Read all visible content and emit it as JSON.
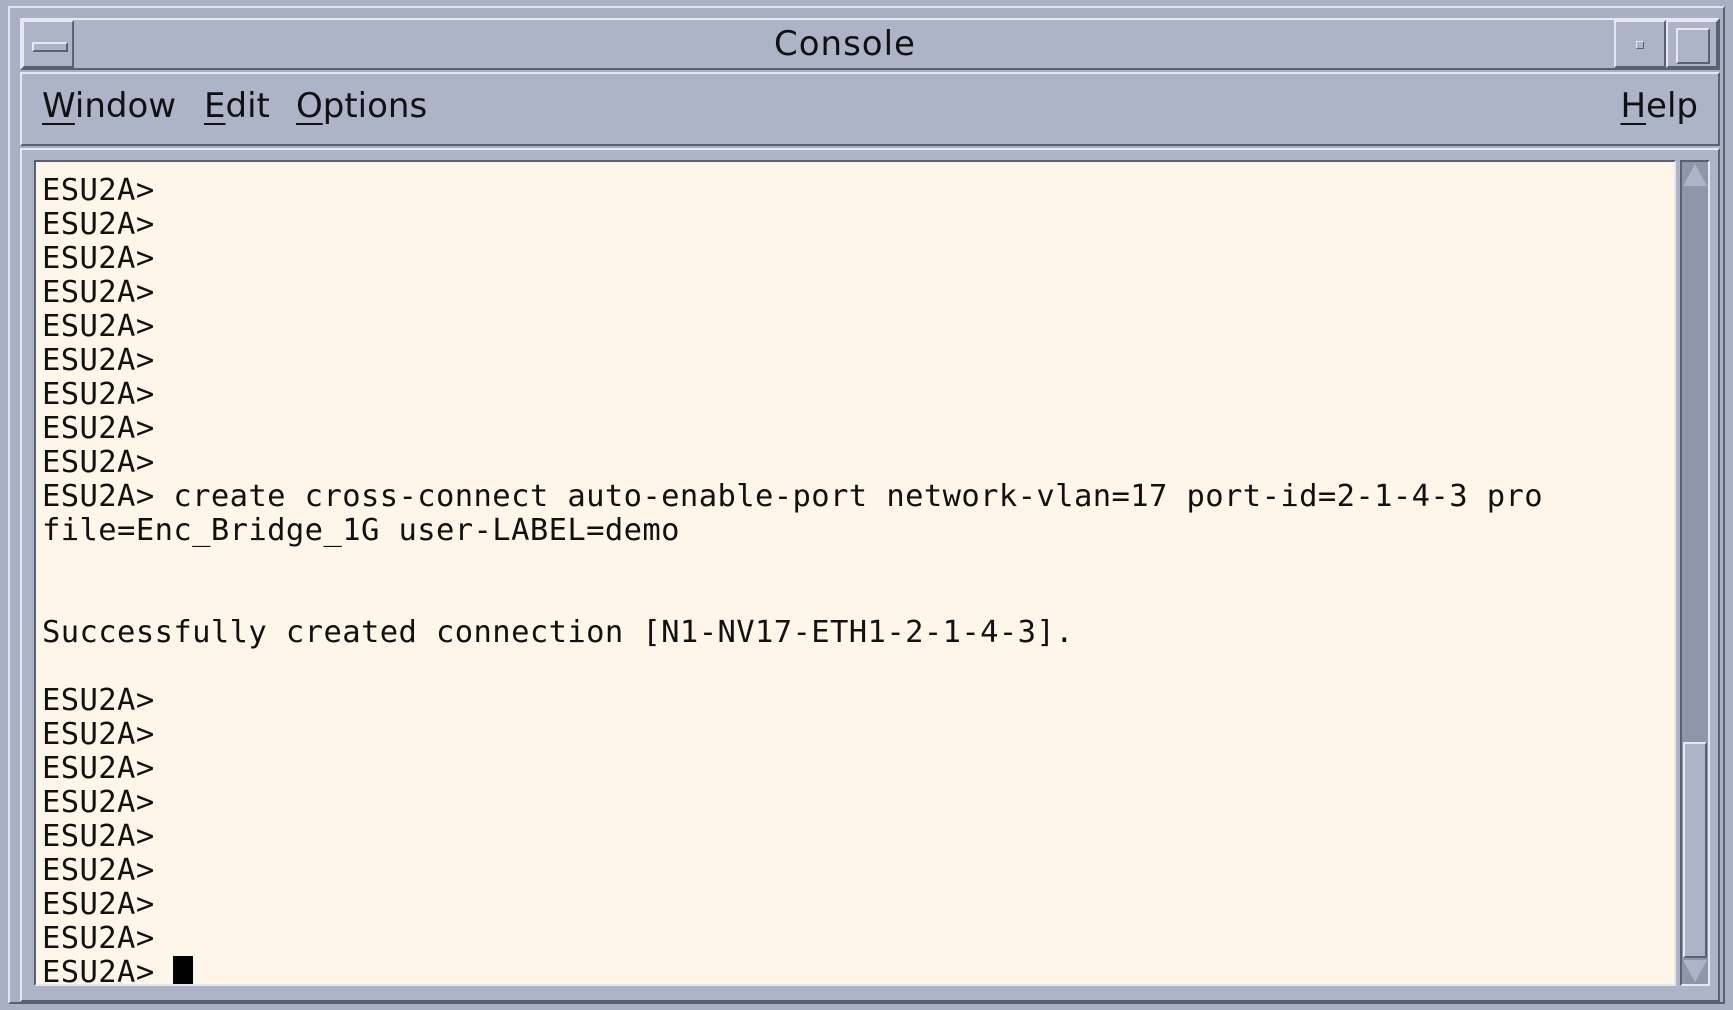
{
  "window": {
    "title": "Console",
    "icons": {
      "menu": "window-menu-icon",
      "minimize": "minimize-icon",
      "maximize": "maximize-icon"
    }
  },
  "menubar": {
    "items": [
      {
        "label": "Window",
        "mnemonic": "W"
      },
      {
        "label": "Edit",
        "mnemonic": "E"
      },
      {
        "label": "Options",
        "mnemonic": "O"
      }
    ],
    "help": {
      "label": "Help",
      "mnemonic": "H"
    }
  },
  "console": {
    "prompt": "ESU2A>",
    "lines": [
      "ESU2A>",
      "ESU2A>",
      "ESU2A>",
      "ESU2A>",
      "ESU2A>",
      "ESU2A>",
      "ESU2A>",
      "ESU2A>",
      "ESU2A>",
      "ESU2A> create cross-connect auto-enable-port network-vlan=17 port-id=2-1-4-3 pro",
      "file=Enc_Bridge_1G user-LABEL=demo",
      "",
      "",
      "Successfully created connection [N1-NV17-ETH1-2-1-4-3].",
      "",
      "ESU2A>",
      "ESU2A>",
      "ESU2A>",
      "ESU2A>",
      "ESU2A>",
      "ESU2A>",
      "ESU2A>",
      "ESU2A>"
    ],
    "current_prompt": "ESU2A> ",
    "colors": {
      "background": "#fef6e8",
      "text": "#111111",
      "chrome": "#aeb4c8"
    }
  },
  "scrollbar": {
    "position_fraction": 0.72,
    "visible_fraction": 0.28
  }
}
